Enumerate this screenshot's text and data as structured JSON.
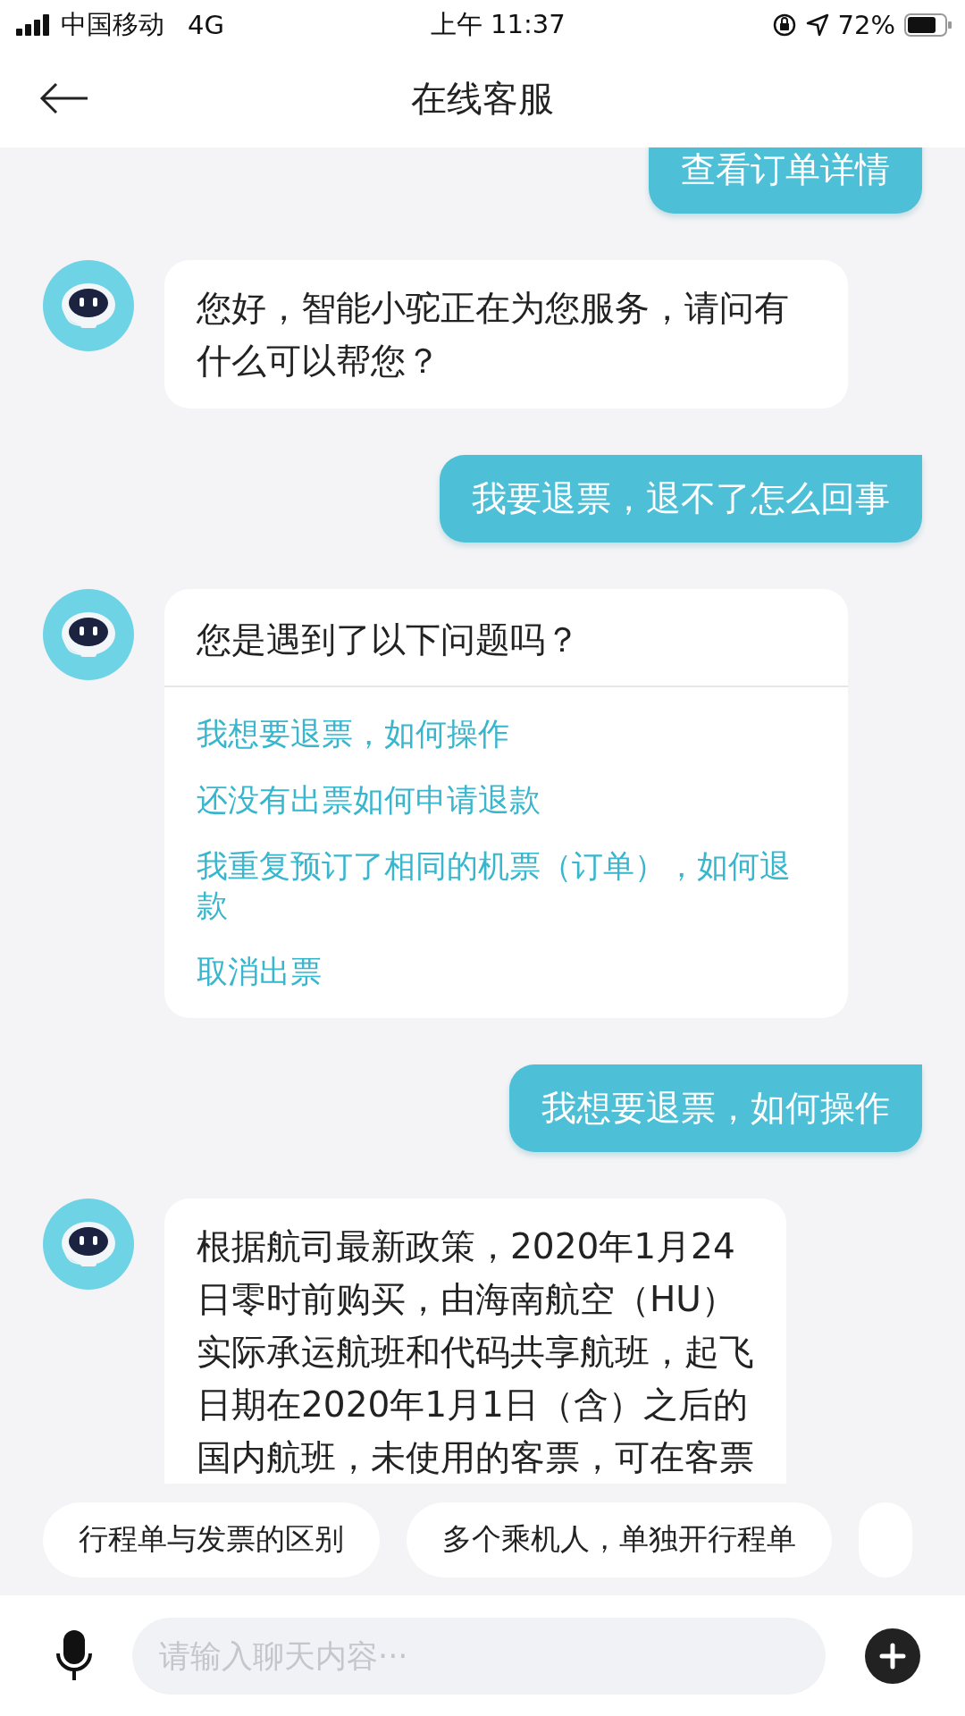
{
  "status_bar": {
    "carrier": "中国移动",
    "network": "4G",
    "time": "上午 11:37",
    "battery_percent": "72%"
  },
  "header": {
    "title": "在线客服"
  },
  "messages": [
    {
      "kind": "user",
      "text": "查看订单详情"
    },
    {
      "kind": "bot",
      "text": "您好，智能小驼正在为您服务，请问有什么可以帮您？"
    },
    {
      "kind": "user",
      "text": "我要退票，退不了怎么回事"
    },
    {
      "kind": "options",
      "text": "您是遇到了以下问题吗？",
      "options": [
        "我想要退票，如何操作",
        "还没有出票如何申请退款",
        "我重复预订了相同的机票（订单），如何退款",
        "取消出票"
      ]
    },
    {
      "kind": "user",
      "text": "我想要退票，如何操作"
    },
    {
      "kind": "bot",
      "lines": [
        "根据航司最新政策，2020年1月24",
        "日零时前购买，由海南航空（HU）",
        "实际承运航班和代码共享航班，起飞",
        "日期在2020年1月1日（含）之后的",
        "国内航班，未使用的客票，可在客票"
      ]
    }
  ],
  "quick_replies": [
    "行程单与发票的区别",
    "多个乘机人，单独开行程单"
  ],
  "input": {
    "placeholder": "请输入聊天内容···"
  }
}
